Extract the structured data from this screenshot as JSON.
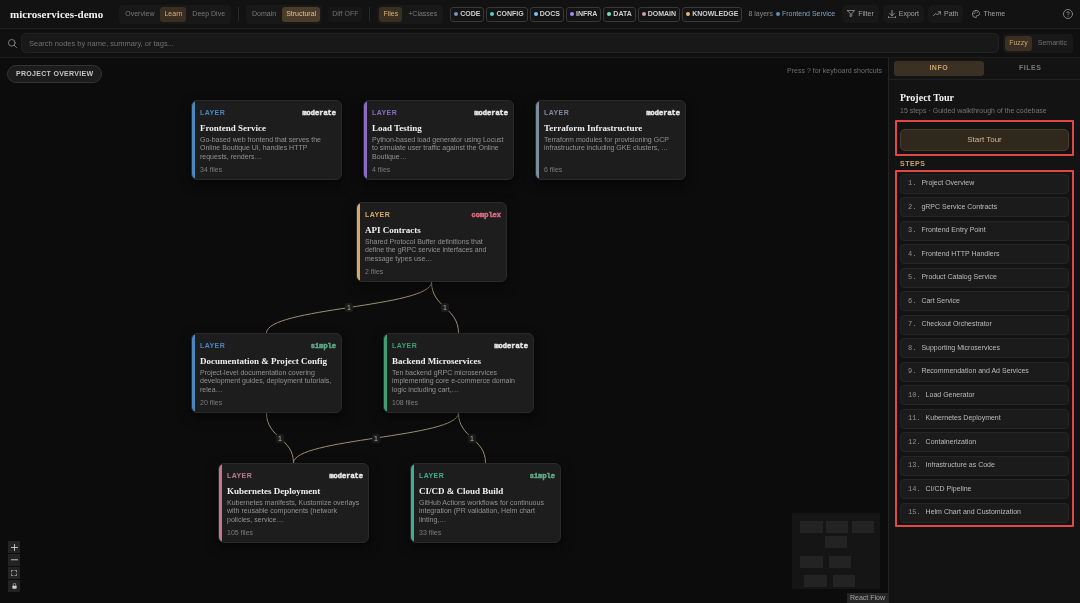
{
  "header": {
    "title": "microservices-demo",
    "view_modes": [
      {
        "label": "Overview",
        "selected": false
      },
      {
        "label": "Learn",
        "selected": true
      },
      {
        "label": "Deep Dive",
        "selected": false
      }
    ],
    "lenses": [
      {
        "label": "Domain",
        "selected": false
      },
      {
        "label": "Structural",
        "selected": true
      }
    ],
    "diff_toggle": {
      "label": "Diff OFF",
      "on": false
    },
    "granularity": [
      {
        "label": "Files",
        "selected": true
      },
      {
        "label": "+Classes",
        "selected": false
      }
    ],
    "legend": [
      {
        "label": "CODE",
        "color": "#6f95b8"
      },
      {
        "label": "CONFIG",
        "color": "#4fd1c5"
      },
      {
        "label": "DOCS",
        "color": "#7cc4f4"
      },
      {
        "label": "INFRA",
        "color": "#a78bfa"
      },
      {
        "label": "DATA",
        "color": "#6ee7b7"
      },
      {
        "label": "DOMAIN",
        "color": "#d19ba6"
      },
      {
        "label": "KNOWLEDGE",
        "color": "#e6b872"
      }
    ],
    "layer_count": "8 layers",
    "focus": {
      "label": "Frontend Service",
      "color": "#5b8fbf"
    },
    "actions": [
      {
        "label": "Filter",
        "kind": "filter"
      },
      {
        "label": "Export",
        "kind": "export"
      },
      {
        "label": "Path",
        "kind": "path"
      },
      {
        "label": "Theme",
        "kind": "theme"
      }
    ]
  },
  "search": {
    "placeholder": "Search nodes by name, summary, or tags...",
    "modes": [
      {
        "label": "Fuzzy",
        "selected": true
      },
      {
        "label": "Semantic",
        "selected": false
      }
    ]
  },
  "canvas": {
    "overview_button": "PROJECT OVERVIEW",
    "hint": "Press ? for keyboard shortcuts",
    "nodes": [
      {
        "tag": "LAYER",
        "complexity": {
          "label": "moderate",
          "color": "#e5e5e5"
        },
        "title": "Frontend Service",
        "summary": "Go-based web frontend that serves the Online Boutique UI, handles HTTP requests, renders…",
        "files": "34 files",
        "color": "#4a86c0"
      },
      {
        "tag": "LAYER",
        "complexity": {
          "label": "moderate",
          "color": "#e5e5e5"
        },
        "title": "Load Testing",
        "summary": "Python-based load generator using Locust to simulate user traffic against the Online Boutique…",
        "files": "4 files",
        "color": "#8b6cc4"
      },
      {
        "tag": "LAYER",
        "complexity": {
          "label": "moderate",
          "color": "#e5e5e5"
        },
        "title": "Terraform Infrastructure",
        "summary": "Terraform modules for provisioning GCP infrastructure including GKE clusters, …",
        "files": "6 files",
        "color": "#7d8aa0"
      },
      {
        "tag": "LAYER",
        "complexity": {
          "label": "complex",
          "color": "#d46a7e"
        },
        "title": "API Contracts",
        "summary": "Shared Protocol Buffer definitions that define the gRPC service interfaces and message types use…",
        "files": "2 files",
        "color": "#d8a964"
      },
      {
        "tag": "LAYER",
        "complexity": {
          "label": "simple",
          "color": "#5fa884"
        },
        "title": "Documentation & Project Config",
        "summary": "Project-level documentation covering development guides, deployment tutorials, relea…",
        "files": "20 files",
        "color": "#4a86c0"
      },
      {
        "tag": "LAYER",
        "complexity": {
          "label": "moderate",
          "color": "#e5e5e5"
        },
        "title": "Backend Microservices",
        "summary": "Ten backend gRPC microservices implementing core e-commerce domain logic including cart,…",
        "files": "108 files",
        "color": "#3f9e74"
      },
      {
        "tag": "LAYER",
        "complexity": {
          "label": "moderate",
          "color": "#e5e5e5"
        },
        "title": "Kubernetes Deployment",
        "summary": "Kubernetes manifests, Kustomize overlays with reusable components (network policies, service…",
        "files": "105 files",
        "color": "#c07a92"
      },
      {
        "tag": "LAYER",
        "complexity": {
          "label": "simple",
          "color": "#5fa884"
        },
        "title": "CI/CD & Cloud Build",
        "summary": "GitHub Actions workflows for continuous integration (PR validation, Helm chart linting,…",
        "files": "33 files",
        "color": "#3fae90"
      }
    ],
    "edges": [
      {
        "label": "1"
      },
      {
        "label": "1"
      },
      {
        "label": "1"
      },
      {
        "label": "1"
      },
      {
        "label": "1"
      }
    ],
    "attribution": "React Flow"
  },
  "sidebar": {
    "tabs": [
      {
        "label": "INFO",
        "selected": true
      },
      {
        "label": "FILES",
        "selected": false
      }
    ],
    "title": "Project Tour",
    "subtitle": "15 steps · Guided walkthrough of the codebase",
    "start_button": {
      "label": "Start Tour",
      "highlighted": true
    },
    "steps_heading": "STEPS",
    "steps_highlighted": true,
    "steps": [
      {
        "number": "1.",
        "title": "Project Overview"
      },
      {
        "number": "2.",
        "title": "gRPC Service Contracts"
      },
      {
        "number": "3.",
        "title": "Frontend Entry Point"
      },
      {
        "number": "4.",
        "title": "Frontend HTTP Handlers"
      },
      {
        "number": "5.",
        "title": "Product Catalog Service"
      },
      {
        "number": "6.",
        "title": "Cart Service"
      },
      {
        "number": "7.",
        "title": "Checkout Orchestrator"
      },
      {
        "number": "8.",
        "title": "Supporting Microservices"
      },
      {
        "number": "9.",
        "title": "Recommendation and Ad Services"
      },
      {
        "number": "10.",
        "title": "Load Generator"
      },
      {
        "number": "11.",
        "title": "Kubernetes Deployment"
      },
      {
        "number": "12.",
        "title": "Containerization"
      },
      {
        "number": "13.",
        "title": "Infrastructure as Code"
      },
      {
        "number": "14.",
        "title": "CI/CD Pipeline"
      },
      {
        "number": "15.",
        "title": "Helm Chart and Customization"
      }
    ]
  }
}
